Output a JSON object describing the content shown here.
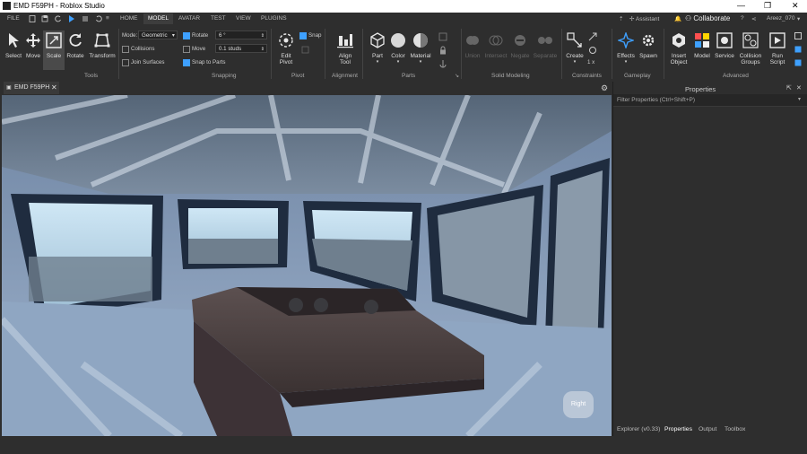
{
  "window": {
    "title": "EMD F59PH - Roblox Studio",
    "user": "Areez_070"
  },
  "menubar": {
    "file": "FILE",
    "tabs": [
      "HOME",
      "MODEL",
      "AVATAR",
      "TEST",
      "VIEW",
      "PLUGINS"
    ],
    "assistant": "Assistant",
    "collaborate": "Collaborate"
  },
  "tools": {
    "select": "Select",
    "move": "Move",
    "scale": "Scale",
    "rotate": "Rotate",
    "transform": "Transform",
    "group": "Tools"
  },
  "snapping": {
    "mode_label": "Mode:",
    "mode_value": "Geometric",
    "collisions": "Collisions",
    "join_surfaces": "Join Surfaces",
    "rotate": "Rotate",
    "rotate_value": "6 °",
    "move": "Move",
    "move_value": "0.1 studs",
    "snap_to_parts": "Snap to Parts",
    "group": "Snapping"
  },
  "pivot": {
    "edit_pivot": "Edit Pivot",
    "snap": "Snap",
    "group": "Pivot"
  },
  "alignment": {
    "align_tool": "Align Tool",
    "group": "Alignment"
  },
  "parts": {
    "part": "Part",
    "color": "Color",
    "material": "Material",
    "group": "Parts"
  },
  "solid_modeling": {
    "union": "Union",
    "intersect": "Intersect",
    "negate": "Negate",
    "separate": "Separate",
    "group": "Solid Modeling"
  },
  "constraints": {
    "create": "Create",
    "scale_value": "1 x",
    "group": "Constraints"
  },
  "gameplay": {
    "effects": "Effects",
    "spawn": "Spawn",
    "group": "Gameplay"
  },
  "advanced": {
    "insert_object": "Insert Object",
    "model": "Model",
    "service": "Service",
    "collision_groups": "Collision Groups",
    "run_script": "Run Script",
    "group": "Advanced"
  },
  "document_tab": {
    "label": "EMD F59PH"
  },
  "properties": {
    "title": "Properties",
    "filter_placeholder": "Filter Properties (Ctrl+Shift+P)"
  },
  "viewcube": {
    "label": "Right"
  },
  "panel_tabs": [
    "Explorer (v0.33)",
    "Properties",
    "Output",
    "Toolbox"
  ],
  "colors": {
    "accent": "#3ea0ff",
    "panel": "#2e2e2e",
    "ribbon_icon": "#e0e0e0"
  }
}
